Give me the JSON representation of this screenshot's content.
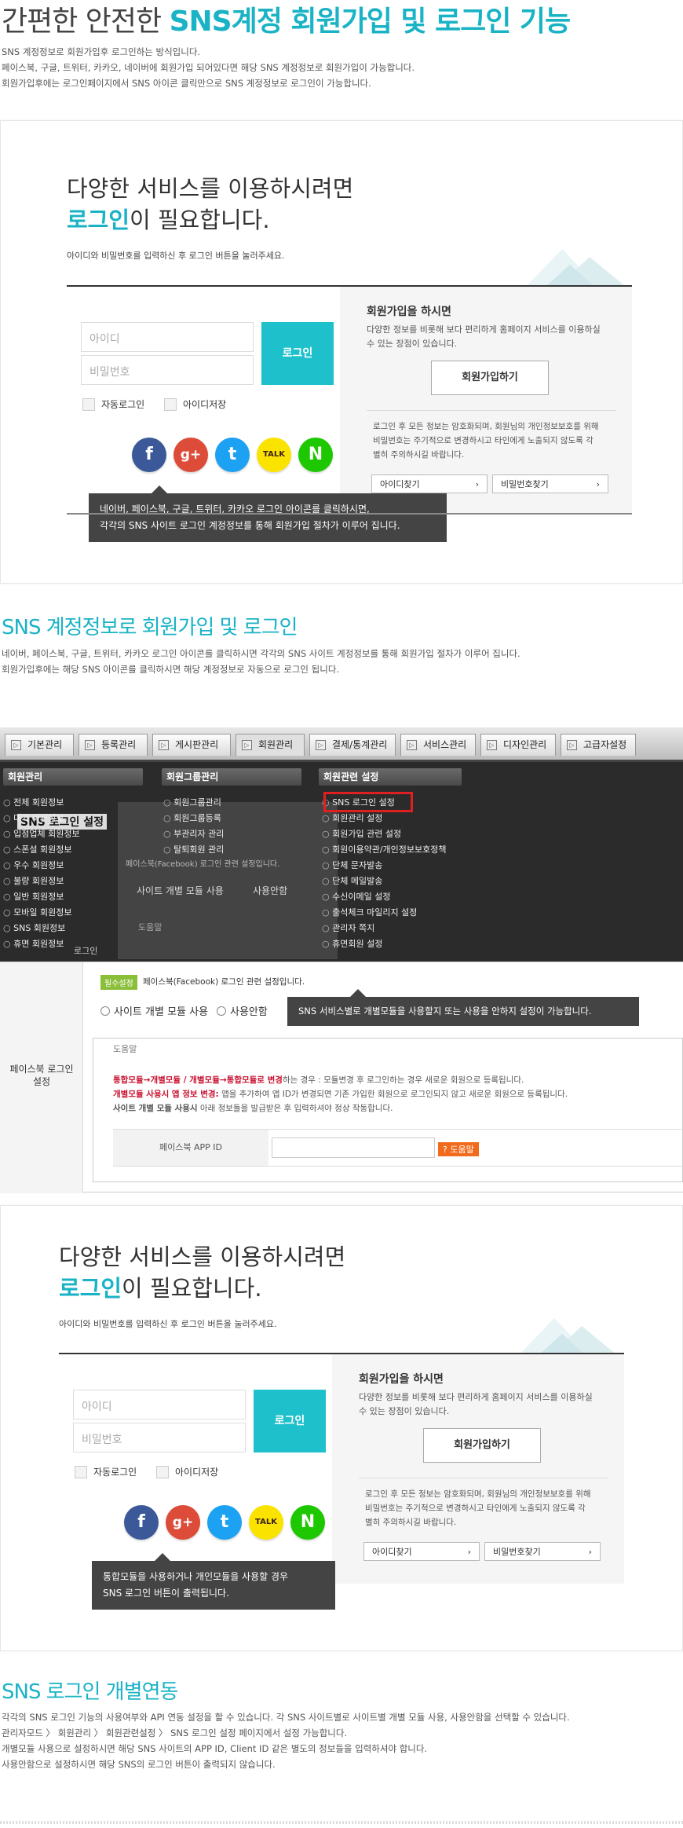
{
  "hero": {
    "title_plain": "간편한 안전한 ",
    "title_highlight": "SNS계정 회원가입 및 로그인 기능",
    "desc": [
      "SNS 계정정보로 회원가입후 로그인하는 방식입니다.",
      "페이스북, 구글, 트위터, 카카오, 네이버에 회원가입 되어있다면 해당 SNS 계정정보로 회원가입이 가능합니다.",
      "회원가입후에는 로그인페이지에서 SNS 아이콘 클릭만으로 SNS 계정정보로 로그인이 가능합니다."
    ]
  },
  "login_mock": {
    "heading_line1": "다양한 서비스를 이용하시려면",
    "heading_highlight": "로그인",
    "heading_rest": "이 필요합니다.",
    "subtext": "아이디와 비밀번호를 입력하신 후 로그인 버튼을 눌러주세요.",
    "id_placeholder": "아이디",
    "pw_placeholder": "비밀번호",
    "login_button": "로그인",
    "auto_login": "자동로그인",
    "save_id": "아이디저장",
    "join_title": "회원가입을 하시면",
    "join_desc": "다양한 정보를 비롯해 보다 편리하게 홈페이지 서비스를 이용하실 수 있는 장점이 있습니다.",
    "join_button": "회원가입하기",
    "privacy_text": "로그인 후 모든 정보는 암호화되며, 회원님의 개인정보보호를 위해 비밀번호는 주기적으로 변경하시고 타인에게 노출되지 않도록 각별히 주의하시길 바랍니다.",
    "find_id": "아이디찾기",
    "find_pw": "비밀번호찾기",
    "tooltip1": [
      "네이버, 페이스북, 구글, 트위터, 카카오 로그인 아이콘를 클릭하시면,",
      "각각의 SNS 사이트 로그인 계정정보를 통해 회원가입 절차가 이루어 집니다."
    ],
    "tooltip2": [
      "통합모듈을 사용하거나 개인모듈을 사용할 경우",
      "SNS 로그인 버튼이 출력됩니다."
    ]
  },
  "sns_icons": [
    {
      "name": "facebook-icon",
      "glyph": "f",
      "color": "#3b5998"
    },
    {
      "name": "google-plus-icon",
      "glyph": "g+",
      "color": "#dd4b39"
    },
    {
      "name": "twitter-icon",
      "glyph": "t",
      "color": "#1da1f2"
    },
    {
      "name": "kakao-icon",
      "glyph": "TALK",
      "color": "#fbe300"
    },
    {
      "name": "naver-icon",
      "glyph": "N",
      "color": "#1ec800"
    }
  ],
  "section2": {
    "title": "SNS 계정정보로 회원가입 및 로그인",
    "desc": [
      "네이버, 페이스북, 구글, 트위터, 카카오 로그인 아이콘를 클릭하시면 각각의 SNS 사이트 계정정보를 통해 회원가입 절차가 이루어 집니다.",
      "회원가입후에는 해당 SNS 아이콘를 클릭하시면 해당 계정정보로 자동으로 로그인 됩니다."
    ]
  },
  "admin": {
    "tabs": [
      "기본관리",
      "등록관리",
      "게시판관리",
      "회원관리",
      "결제/통계관리",
      "서비스관리",
      "디자인관리",
      "고급자설정"
    ],
    "menu_heads": [
      "회원관리",
      "회원그룹관리",
      "회원관련 설정"
    ],
    "col1": [
      "전체 회원정보",
      "대기 회원정보",
      "입점업체 회원정보",
      "스폰설 회원정보",
      "우수 회원정보",
      "불량 회원정보",
      "일반 회원정보",
      "모바일 회원정보",
      "SNS 회원정보",
      "휴면 회원정보"
    ],
    "col2": [
      "회원그룹관리",
      "회원그룹등록",
      "부관리자 관리",
      "탈퇴회원 관리"
    ],
    "col3": [
      "SNS 로그인 설정",
      "회원관리 설정",
      "회원가입 관련 설정",
      "회원이용약관/개인정보보호정책",
      "단체 문자발송",
      "단체 메일발송",
      "수신이메일 설정",
      "출석체크 마일리지 설정",
      "관리자 쪽지",
      "휴면회원 설정"
    ],
    "bg_title": "SNS 로그인 설정",
    "bg_tag": "페이스북(Facebook) 로그인 관련 설정입니다.",
    "bg_radio1": "사이트 개별 모듈 사용",
    "bg_radio2": "사용안함",
    "bg_help": "도움말",
    "bg_side": "로그인"
  },
  "settings": {
    "side_label": "페이스북 로그인 설정",
    "tag": "필수설정",
    "tag_text": "페이스북(Facebook) 로그인 관련 설정입니다.",
    "radio1": "사이트 개별 모듈 사용",
    "radio2": "사용안함",
    "tooltip": "SNS 서비스별로 개별모듈을 사용할지 또는 사용을 안하지 설정이 가능합니다.",
    "help_title": "도움말",
    "help1_red": "통합모듈→개별모듈 / 개별모듈→통합모듈로 변경",
    "help1_rest": "하는 경우 : 모듈변경 후 로그인하는 경우 새로운 회원으로 등록됩니다.",
    "help2_red": "개별모듈 사용시 앱 정보 변경:",
    "help2_rest": " 앱을 추가하여 앱 ID가 변경되면 기존 가입한 회원으로 로그인되지 않고 새로운 회원으로 등록됩니다.",
    "help3_bold": "사이트 개별 모듈 사용시",
    "help3_rest": " 아래 정보들을 발급받은 후 입력하셔야 정상 작동합니다.",
    "app_id_label": "페이스북 APP ID",
    "help_badge": "도움말"
  },
  "section3": {
    "title": "SNS 로그인 개별연동",
    "desc": [
      "각각의 SNS 로그인 기능의 사용여부와 API 연동 설정을 할 수 있습니다. 각 SNS 사이트별로 사이트별 개별 모듈 사용, 사용안함을 선택할 수 있습니다.",
      "관리자모드 〉 회원관리 〉 회원관련설정 〉 SNS 로그인 설정 페이지에서 설정 가능합니다.",
      "개별모듈 사용으로 설정하시면 해당 SNS 사이트의 APP ID, Client ID 같은 별도의 정보들을 입력하셔야 합니다.",
      "사용안함으로 설정하시면 해당 SNS의 로그인 버튼이 출력되지 않습니다."
    ]
  }
}
